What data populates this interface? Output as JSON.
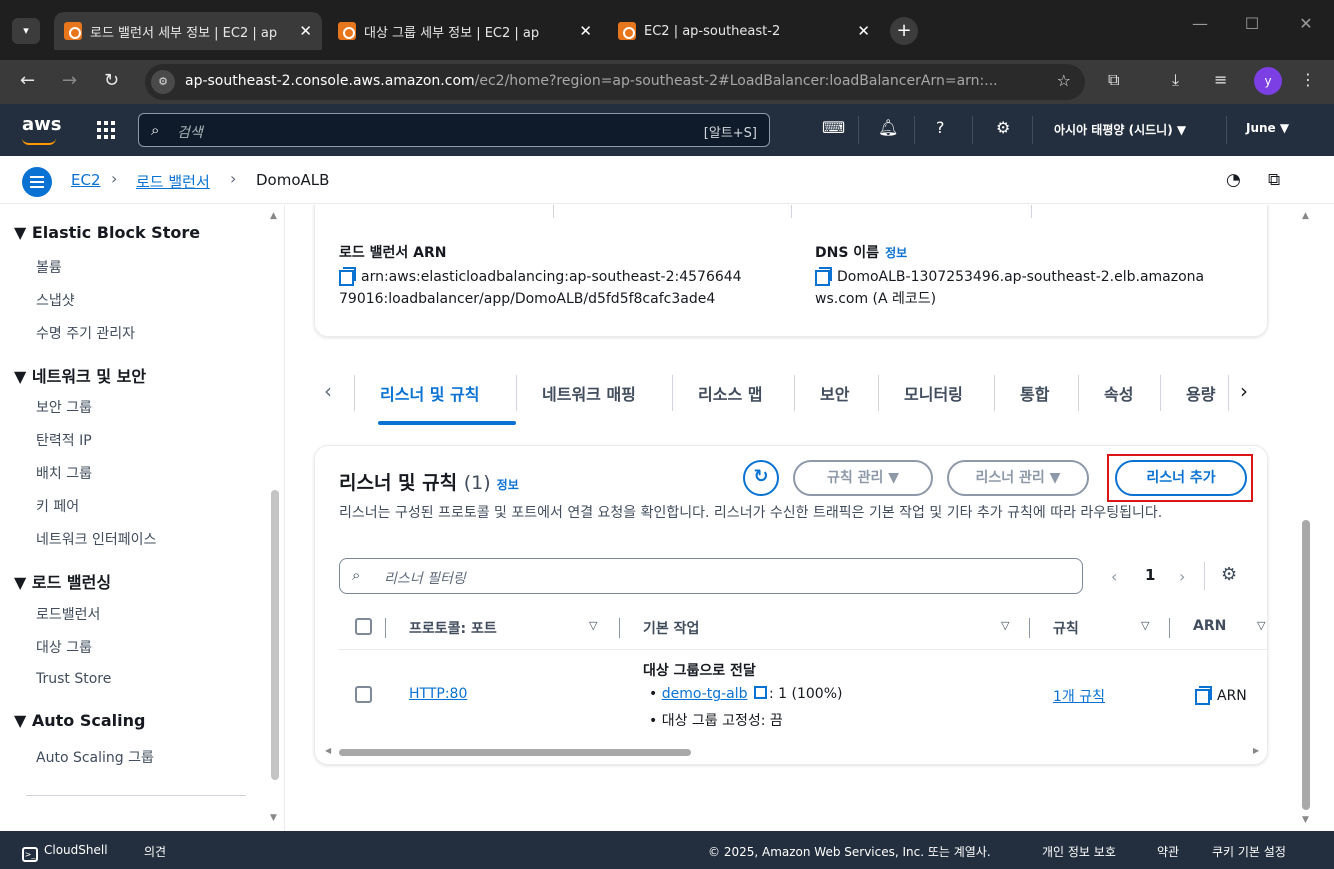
{
  "browser": {
    "tabs": [
      {
        "label": "로드 밸런서 세부 정보 | EC2 | ap",
        "active": true
      },
      {
        "label": "대상 그룹 세부 정보 | EC2 | ap",
        "active": false
      },
      {
        "label": "EC2 | ap-southeast-2",
        "active": false
      }
    ],
    "new_tab": "+",
    "url_host": "ap-southeast-2.console.aws.amazon.com",
    "url_rest": "/ec2/home?region=ap-southeast-2#LoadBalancer:loadBalancerArn=arn:...",
    "profile_initial": "y"
  },
  "aws_nav": {
    "logo": "aws",
    "search_placeholder": "검색",
    "search_shortcut": "[알트+S]",
    "region": "아시아 태평양 (시드니) ▼",
    "user": "June ▼"
  },
  "breadcrumb": {
    "items": [
      "EC2",
      "로드 밸런서"
    ],
    "current": "DomoALB"
  },
  "sidebar": {
    "sections": [
      {
        "title": "▼ Elastic Block Store",
        "items": [
          "볼륨",
          "스냅샷",
          "수명 주기 관리자"
        ]
      },
      {
        "title": "▼ 네트워크 및 보안",
        "items": [
          "보안 그룹",
          "탄력적 IP",
          "배치 그룹",
          "키 페어",
          "네트워크 인터페이스"
        ]
      },
      {
        "title": "▼ 로드 밸런싱",
        "items": [
          "로드밸런서",
          "대상 그룹",
          "Trust Store"
        ]
      },
      {
        "title": "▼ Auto Scaling",
        "items": [
          "Auto Scaling 그룹"
        ]
      }
    ]
  },
  "details": {
    "arn_label": "로드 밸런서 ARN",
    "arn_line1": "arn:aws:elasticloadbalancing:ap-southeast-2:4576644",
    "arn_line2": "79016:loadbalancer/app/DomoALB/d5fd5f8cafc3ade4",
    "dns_label": "DNS 이름",
    "dns_info": "정보",
    "dns_line1": "DomoALB-1307253496.ap-southeast-2.elb.amazona",
    "dns_line2": "ws.com (A 레코드)"
  },
  "tabs": [
    "리스너 및 규칙",
    "네트워크 매핑",
    "리소스 맵",
    "보안",
    "모니터링",
    "통합",
    "속성",
    "용량"
  ],
  "listeners": {
    "title": "리스너 및 규칙",
    "count": "(1)",
    "info": "정보",
    "manage_rules": "규칙 관리 ▼",
    "manage_listener": "리스너 관리 ▼",
    "add_listener": "리스너 추가",
    "description": "리스너는 구성된 프로토콜 및 포트에서 연결 요청을 확인합니다. 리스너가 수신한 트래픽은 기본 작업 및 기타 추가 규칙에 따라 라우팅됩니다.",
    "filter_placeholder": "리스너 필터링",
    "page": "1",
    "columns": [
      "프로토콜: 포트",
      "기본 작업",
      "규칙",
      "ARN"
    ],
    "rows": [
      {
        "protocol_port": "HTTP:80",
        "action_title": "대상 그룹으로 전달",
        "target_group": "demo-tg-alb",
        "target_weight": ": 1 (100%)",
        "stickiness": "• 대상 그룹 고정성: 끔",
        "rules": "1개 규칙",
        "arn": "ARN"
      }
    ]
  },
  "footer": {
    "cloudshell": "CloudShell",
    "feedback": "의견",
    "copyright": "© 2025, Amazon Web Services, Inc. 또는 계열사.",
    "privacy": "개인 정보 보호",
    "terms": "약관",
    "cookies": "쿠키 기본 설정"
  }
}
